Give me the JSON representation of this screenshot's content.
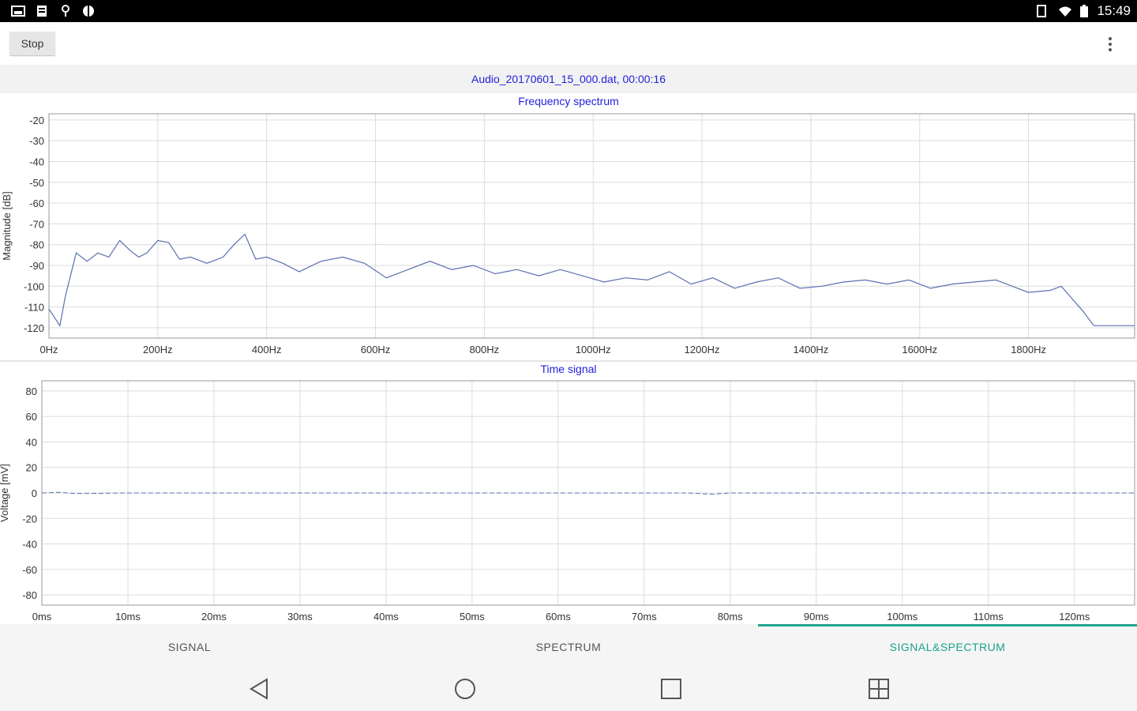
{
  "status_bar": {
    "time": "15:49",
    "left_icons": [
      "image-icon",
      "storage-icon",
      "location-icon",
      "android-icon"
    ],
    "right_icons": [
      "tablet-icon",
      "wifi-icon",
      "battery-icon"
    ]
  },
  "toolbar": {
    "stop_label": "Stop",
    "overflow_icon": "more-vert-icon"
  },
  "file_info": "Audio_20170601_15_000.dat, 00:00:16",
  "spectrum": {
    "title": "Frequency spectrum",
    "ylabel": "Magnitude [dB]",
    "yticks": [
      "-20",
      "-30",
      "-40",
      "-50",
      "-60",
      "-70",
      "-80",
      "-90",
      "-100",
      "-110",
      "-120"
    ],
    "xticks": [
      "0Hz",
      "200Hz",
      "400Hz",
      "600Hz",
      "800Hz",
      "1000Hz",
      "1200Hz",
      "1400Hz",
      "1600Hz",
      "1800Hz"
    ]
  },
  "time_signal": {
    "title": "Time signal",
    "ylabel": "Voltage [mV]",
    "yticks": [
      "80",
      "60",
      "40",
      "20",
      "0",
      "-20",
      "-40",
      "-60",
      "-80"
    ],
    "xticks": [
      "0ms",
      "10ms",
      "20ms",
      "30ms",
      "40ms",
      "50ms",
      "60ms",
      "70ms",
      "80ms",
      "90ms",
      "100ms",
      "110ms",
      "120ms"
    ]
  },
  "tabs": [
    {
      "label": "SIGNAL",
      "active": false
    },
    {
      "label": "SPECTRUM",
      "active": false
    },
    {
      "label": "SIGNAL&SPECTRUM",
      "active": true
    }
  ],
  "nav": [
    "back-icon",
    "home-icon",
    "recents-icon",
    "split-screen-icon"
  ],
  "colors": {
    "accent": "#22a590",
    "title_blue": "#2222dd",
    "trace": "#5a6fb0"
  },
  "chart_data": [
    {
      "type": "line",
      "title": "Frequency spectrum",
      "xlabel": "",
      "ylabel": "Magnitude [dB]",
      "xlim": [
        0,
        1995
      ],
      "ylim": [
        -125,
        -17
      ],
      "grid": true,
      "series": [
        {
          "x": [
            0,
            20,
            30,
            50,
            70,
            90,
            110,
            130,
            150,
            165,
            180,
            200,
            220,
            240,
            260,
            290,
            320,
            340,
            360,
            380,
            400,
            430,
            460,
            500,
            540,
            580,
            620,
            660,
            700,
            740,
            780,
            820,
            860,
            900,
            940,
            980,
            1020,
            1060,
            1100,
            1140,
            1180,
            1220,
            1260,
            1300,
            1340,
            1380,
            1420,
            1460,
            1500,
            1540,
            1580,
            1620,
            1660,
            1700,
            1740,
            1780,
            1800,
            1840,
            1860,
            1880,
            1900,
            1920,
            1940,
            1960,
            1980,
            1995
          ],
          "y": [
            -111,
            -119,
            -105,
            -84,
            -88,
            -84,
            -86,
            -78,
            -83,
            -86,
            -84,
            -78,
            -79,
            -87,
            -86,
            -89,
            -86,
            -80,
            -75,
            -87,
            -86,
            -89,
            -93,
            -88,
            -86,
            -89,
            -96,
            -92,
            -88,
            -92,
            -90,
            -94,
            -92,
            -95,
            -92,
            -95,
            -98,
            -96,
            -97,
            -93,
            -99,
            -96,
            -101,
            -98,
            -96,
            -101,
            -100,
            -98,
            -97,
            -99,
            -97,
            -101,
            -99,
            -98,
            -97,
            -101,
            -103,
            -102,
            -100,
            -106,
            -112,
            -119,
            -119,
            -119,
            -119,
            -119
          ]
        }
      ]
    },
    {
      "type": "line",
      "title": "Time signal",
      "xlabel": "",
      "ylabel": "Voltage [mV]",
      "xlim": [
        0,
        127
      ],
      "ylim": [
        -88,
        88
      ],
      "grid": true,
      "series": [
        {
          "x": [
            0,
            2,
            4,
            10,
            20,
            30,
            40,
            50,
            60,
            70,
            75,
            78,
            80,
            90,
            100,
            110,
            120,
            127
          ],
          "y": [
            0,
            0.5,
            -0.5,
            0,
            0,
            0,
            0,
            0,
            0,
            0,
            0,
            -1,
            0,
            0,
            0,
            0,
            0,
            0
          ]
        }
      ]
    }
  ]
}
